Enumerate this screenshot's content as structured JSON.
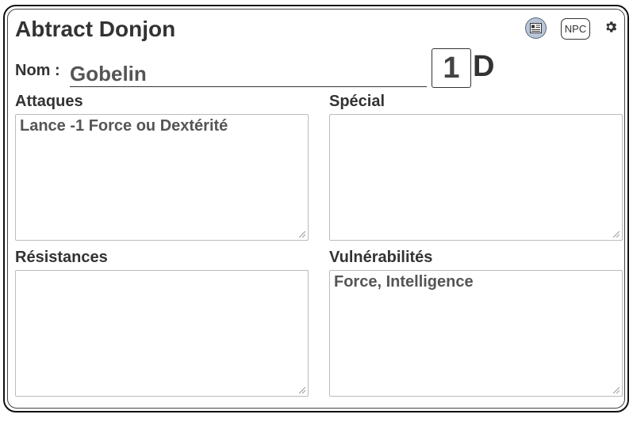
{
  "header": {
    "title": "Abtract Donjon",
    "npc_label": "NPC",
    "icons": [
      "sheet-icon",
      "gear-icon"
    ]
  },
  "identity": {
    "name_label": "Nom :",
    "name_value": "Gobelin",
    "level_value": "1",
    "level_suffix": "D"
  },
  "fields": {
    "attacks": {
      "label": "Attaques",
      "value": "Lance -1 Force ou Dextérité"
    },
    "special": {
      "label": "Spécial",
      "value": ""
    },
    "resistances": {
      "label": "Résistances",
      "value": ""
    },
    "vulnerabilities": {
      "label": "Vulnérabilités",
      "value": "Force, Intelligence"
    }
  },
  "colors": {
    "sheet_button_bg": "#b9c5d8",
    "text": "#333333"
  }
}
